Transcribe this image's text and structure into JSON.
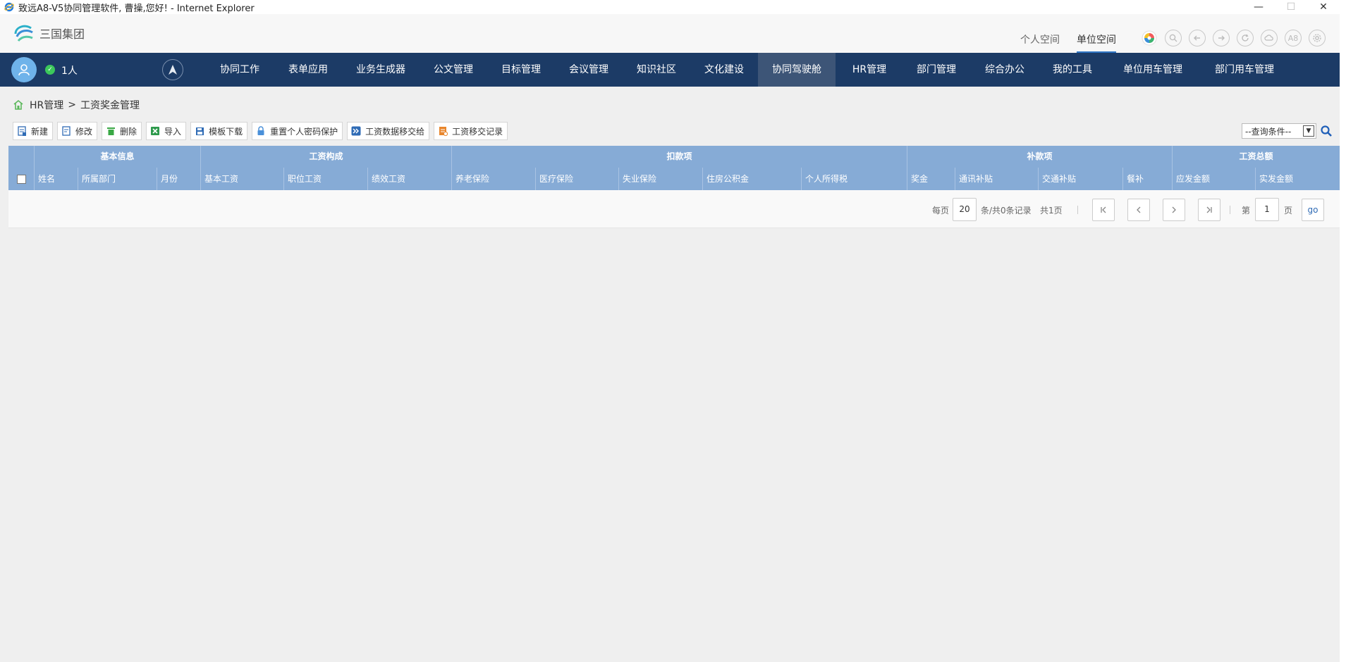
{
  "window": {
    "title": "致远A8-V5协同管理软件, 曹操,您好! - Internet Explorer",
    "minimize": "—",
    "maximize": "☐",
    "close": "✕"
  },
  "header": {
    "company": "三国集团",
    "space_tabs": [
      "个人空间",
      "单位空间"
    ],
    "active_space": "单位空间",
    "tool_icon_names": [
      "color-wheel-icon",
      "search-icon",
      "back-icon",
      "forward-icon",
      "refresh-icon",
      "cloud-icon",
      "font-icon",
      "settings-icon"
    ],
    "font_icon_text": "A8"
  },
  "nav": {
    "online_count": "1人",
    "items": [
      "协同工作",
      "表单应用",
      "业务生成器",
      "公文管理",
      "目标管理",
      "会议管理",
      "知识社区",
      "文化建设",
      "协同驾驶舱",
      "HR管理",
      "部门管理",
      "综合办公",
      "我的工具",
      "单位用车管理",
      "部门用车管理"
    ],
    "active": "协同驾驶舱"
  },
  "breadcrumb": {
    "root": "HR管理",
    "separator": ">",
    "current": "工资奖金管理"
  },
  "toolbar": {
    "buttons": [
      "新建",
      "修改",
      "删除",
      "导入",
      "模板下载",
      "重置个人密码保护",
      "工资数据移交给",
      "工资移交记录"
    ]
  },
  "search": {
    "selected": "--查询条件--"
  },
  "grid": {
    "groups": [
      "基本信息",
      "工资构成",
      "扣款项",
      "补款项",
      "工资总额"
    ],
    "columns": [
      "姓名",
      "所属部门",
      "月份",
      "基本工资",
      "职位工资",
      "绩效工资",
      "养老保险",
      "医疗保险",
      "失业保险",
      "住房公积金",
      "个人所得税",
      "奖金",
      "通讯补贴",
      "交通补贴",
      "餐补",
      "应发金额",
      "实发金额"
    ]
  },
  "pager": {
    "per_page_label": "每页",
    "per_page": "20",
    "records_label": "条/共0条记录",
    "total_pages": "共1页",
    "page_label_pre": "第",
    "page": "1",
    "page_label_post": "页",
    "go": "go"
  },
  "colors": {
    "nav_bg": "#1c3b66",
    "nav_active": "#3d5577",
    "grid_header": "#86abd6",
    "accent": "#2f76c5"
  }
}
